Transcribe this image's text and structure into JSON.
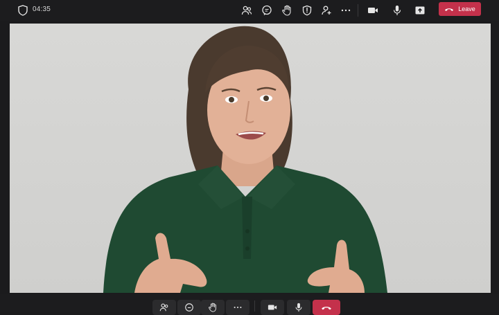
{
  "meeting": {
    "elapsed_time": "04:35"
  },
  "top_toolbar": {
    "icons": [
      "people-icon",
      "chat-icon",
      "raise-hand-icon",
      "shield-icon",
      "add-person-icon",
      "more-options-icon",
      "camera-icon",
      "microphone-icon",
      "share-screen-icon"
    ],
    "leave_label": "Leave"
  },
  "bottom_toolbar": {
    "icons": [
      "people-icon",
      "chat-icon",
      "raise-hand-icon",
      "more-options-icon",
      "camera-icon",
      "microphone-icon",
      "hang-up-icon"
    ]
  },
  "colors": {
    "leave_red": "#c4314b",
    "bar_bg": "#1c1c1e",
    "icon": "#e6e6e6"
  }
}
